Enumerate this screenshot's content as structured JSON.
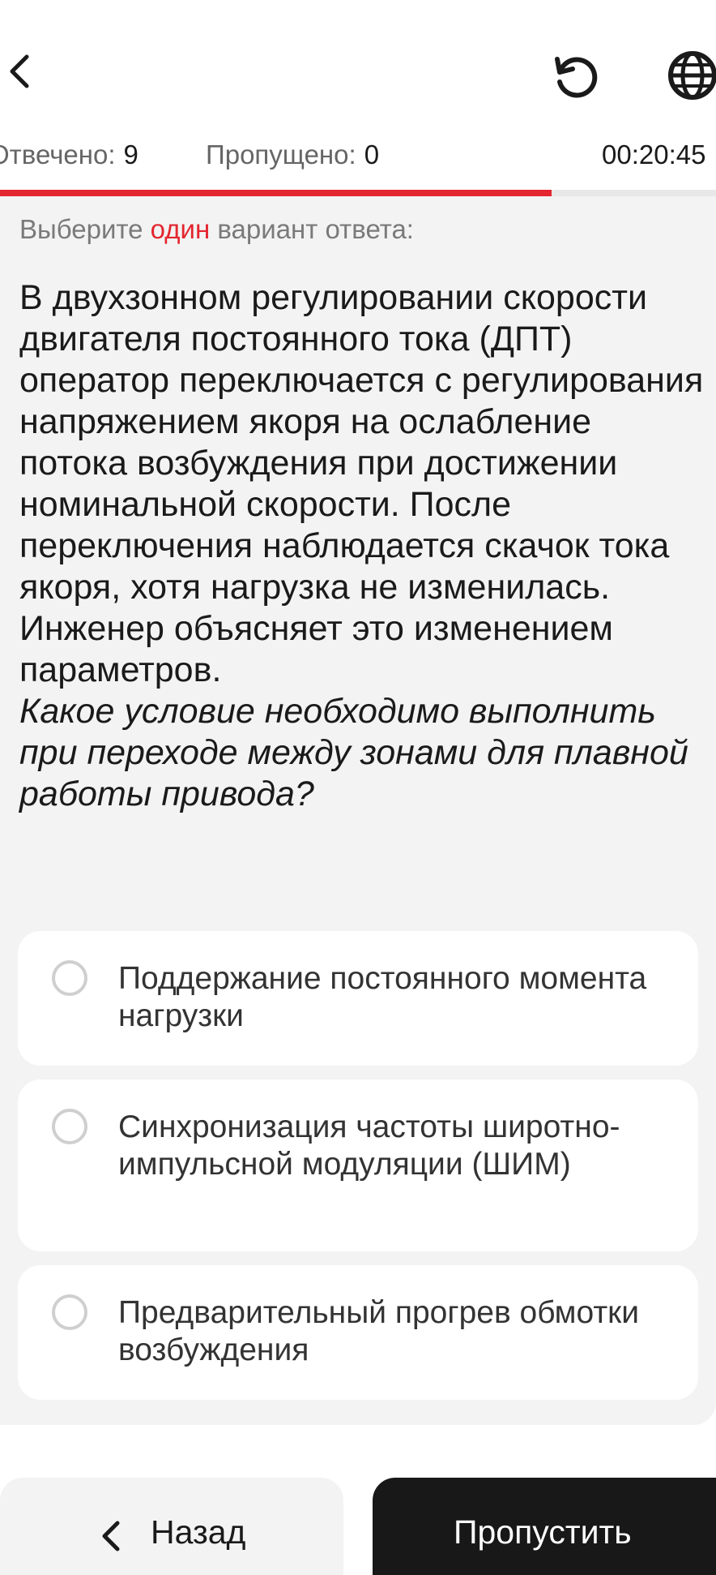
{
  "header": {
    "back_icon": "chevron-left-icon",
    "reset_icon": "refresh-icon",
    "language_icon": "globe-icon"
  },
  "stats": {
    "answered_label": "Отвечено:",
    "answered_value": "9",
    "skipped_label": "Пропущено:",
    "skipped_value": "0",
    "timer": "00:20:45"
  },
  "progress": {
    "fraction": 0.77,
    "color": "#e3262f"
  },
  "instruction": {
    "prefix": "Выберите",
    "highlight": "один",
    "suffix": "вариант ответа:"
  },
  "question": {
    "body": "В двухзонном регулировании скорости двигателя постоянного тока (ДПТ) оператор переключается с регулирования напряжением якоря на ослабление потока возбуждения при достижении номинальной скорости. После переключения наблюдается скачок тока якоря, хотя нагрузка не изменилась. Инженер объясняет это изменением параметров.",
    "prompt": "Какое условие необходимо выполнить при переходе между зонами для плавной работы привода?"
  },
  "options": [
    {
      "text": "Поддержание постоянного момента нагрузки",
      "selected": false
    },
    {
      "text": "Синхронизация частоты широтно-импульсной модуляции (ШИМ)",
      "selected": false
    },
    {
      "text": "Предварительный прогрев обмотки возбуждения",
      "selected": false
    }
  ],
  "footer": {
    "back_label": "Назад",
    "skip_label": "Пропустить"
  },
  "colors": {
    "accent": "#e3262f",
    "background": "#f3f3f3",
    "primary_button": "#181818"
  }
}
